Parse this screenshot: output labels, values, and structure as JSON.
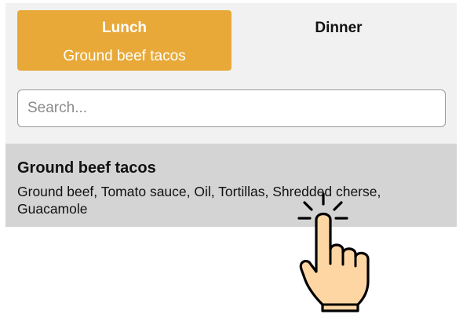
{
  "tabs": [
    {
      "label": "Lunch",
      "sub": "Ground beef tacos",
      "active": true
    },
    {
      "label": "Dinner",
      "active": false
    }
  ],
  "search": {
    "placeholder": "Search...",
    "value": ""
  },
  "result": {
    "title": "Ground beef tacos",
    "ingredients": "Ground beef, Tomato sauce, Oil, Tortillas, Shredded cherse, Guacamole"
  },
  "colors": {
    "accent": "#e8a938",
    "panel": "#f1f1f1",
    "result_bg": "#d4d4d4",
    "hand_fill": "#fdd6a4"
  },
  "icons": {
    "pointer": "tap-hand-icon"
  }
}
